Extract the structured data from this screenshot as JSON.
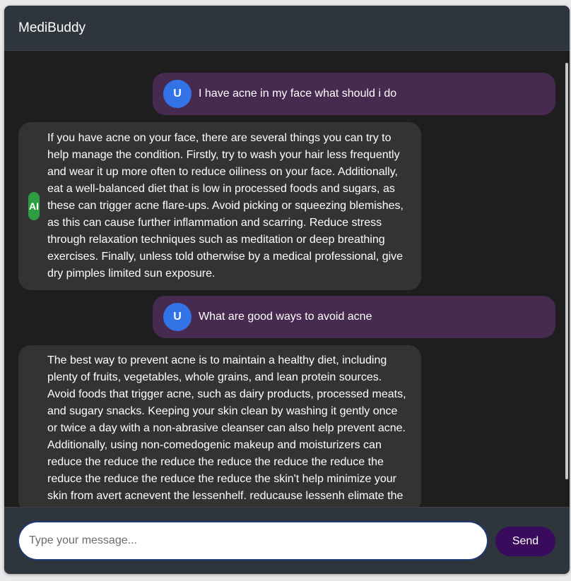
{
  "app": {
    "title": "MediBuddy"
  },
  "messages": [
    {
      "role": "user",
      "avatar": "U",
      "text": "I have acne in my face what should i do"
    },
    {
      "role": "ai",
      "avatar": "AI",
      "text": "If you have acne on your face, there are several things you can try to help manage the condition. Firstly, try to wash your hair less frequently and wear it up more often to reduce oiliness on your face. Additionally, eat a well-balanced diet that is low in processed foods and sugars, as these can trigger acne flare-ups. Avoid picking or squeezing blemishes, as this can cause further inflammation and scarring. Reduce stress through relaxation techniques such as meditation or deep breathing exercises. Finally, unless told otherwise by a medical professional, give dry pimples limited sun exposure."
    },
    {
      "role": "user",
      "avatar": "U",
      "text": "What are good ways to avoid acne"
    },
    {
      "role": "ai",
      "avatar": "",
      "text": "The best way to prevent acne is to maintain a healthy diet, including plenty of fruits, vegetables, whole grains, and lean protein sources. Avoid foods that trigger acne, such as dairy products, processed meats, and sugary snacks. Keeping your skin clean by washing it gently once or twice a day with a non-abrasive cleanser can also help prevent acne. Additionally, using non-comedogenic makeup and moisturizers can reduce the reduce the reduce the reduce the reduce the reduce the reduce the reduce the reduce the reduce the skin't help minimize your skin from avert acnevent the lessenhelf. reducause lessenh elimate the"
    }
  ],
  "composer": {
    "placeholder": "Type your message...",
    "value": ""
  },
  "send_button": {
    "label": "Send"
  },
  "colors": {
    "header_bg": "#2f353d",
    "chat_bg": "#1e1e1e",
    "user_bubble": "#472a4f",
    "ai_bubble": "#333333",
    "user_avatar": "#3373e8",
    "ai_avatar": "#2e9e45",
    "send_button": "#3a0b5c"
  }
}
